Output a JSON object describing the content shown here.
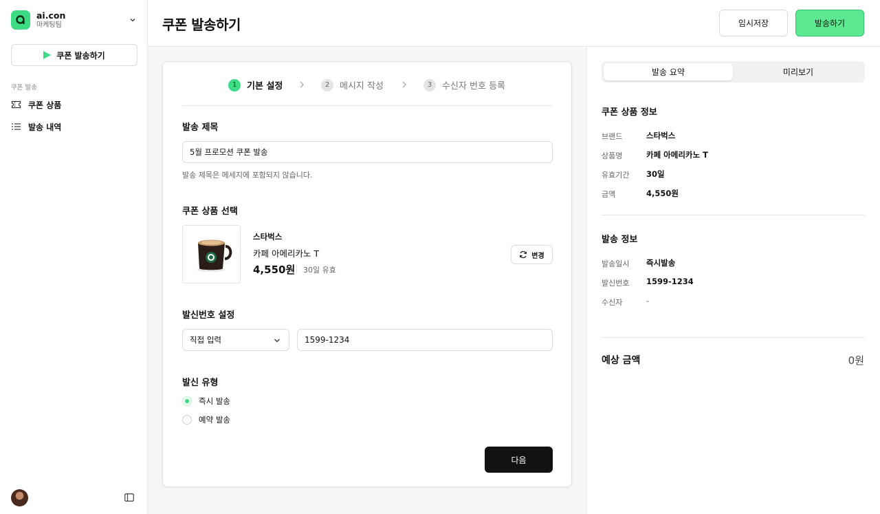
{
  "org": {
    "name": "ai.con",
    "team": "마케팅팀"
  },
  "sidebar": {
    "send_button": "쿠폰 발송하기",
    "section_label": "쿠폰 발송",
    "items": [
      {
        "label": "쿠폰 상품",
        "icon": "ticket-icon"
      },
      {
        "label": "발송 내역",
        "icon": "list-icon"
      }
    ]
  },
  "header": {
    "title": "쿠폰 발송하기",
    "draft_button": "임시저장",
    "send_button": "발송하기"
  },
  "steps": [
    {
      "num": "1",
      "label": "기본 설정",
      "active": true
    },
    {
      "num": "2",
      "label": "메시지 작성",
      "active": false
    },
    {
      "num": "3",
      "label": "수신자 번호 등록",
      "active": false
    }
  ],
  "form": {
    "title_label": "발송 제목",
    "title_value": "5월 프로모션 쿠폰 발송",
    "title_helper": "발송 제목은 메세지에 포함되지 않습니다.",
    "product_label": "쿠폰 상품 선택",
    "product": {
      "brand": "스타벅스",
      "name": "카페 아메리카노 T",
      "price": "4,550원",
      "validity": "30일 유효"
    },
    "change_button": "변경",
    "sender_label": "발신번호 설정",
    "sender_select": "직접 입력",
    "sender_number": "1599-1234",
    "type_label": "발신 유형",
    "type_options": [
      {
        "label": "즉시 발송",
        "checked": true
      },
      {
        "label": "예약 발송",
        "checked": false
      }
    ],
    "next_button": "다음"
  },
  "summary": {
    "tabs": [
      "발송 요약",
      "미리보기"
    ],
    "product_info_title": "쿠폰 상품 정보",
    "product_info": [
      {
        "key": "브랜드",
        "value": "스타벅스"
      },
      {
        "key": "상품명",
        "value": "카페 아메리카노 T"
      },
      {
        "key": "유효기간",
        "value": "30일"
      },
      {
        "key": "금액",
        "value": "4,550원"
      }
    ],
    "send_info_title": "발송 정보",
    "send_info": [
      {
        "key": "발송일시",
        "value": "즉시발송"
      },
      {
        "key": "발신번호",
        "value": "1599-1234"
      },
      {
        "key": "수신자",
        "value": "-"
      }
    ],
    "total_label": "예상 금액",
    "total_value": "0원"
  },
  "colors": {
    "accent": "#3ddc84",
    "primary_dark": "#111111"
  }
}
